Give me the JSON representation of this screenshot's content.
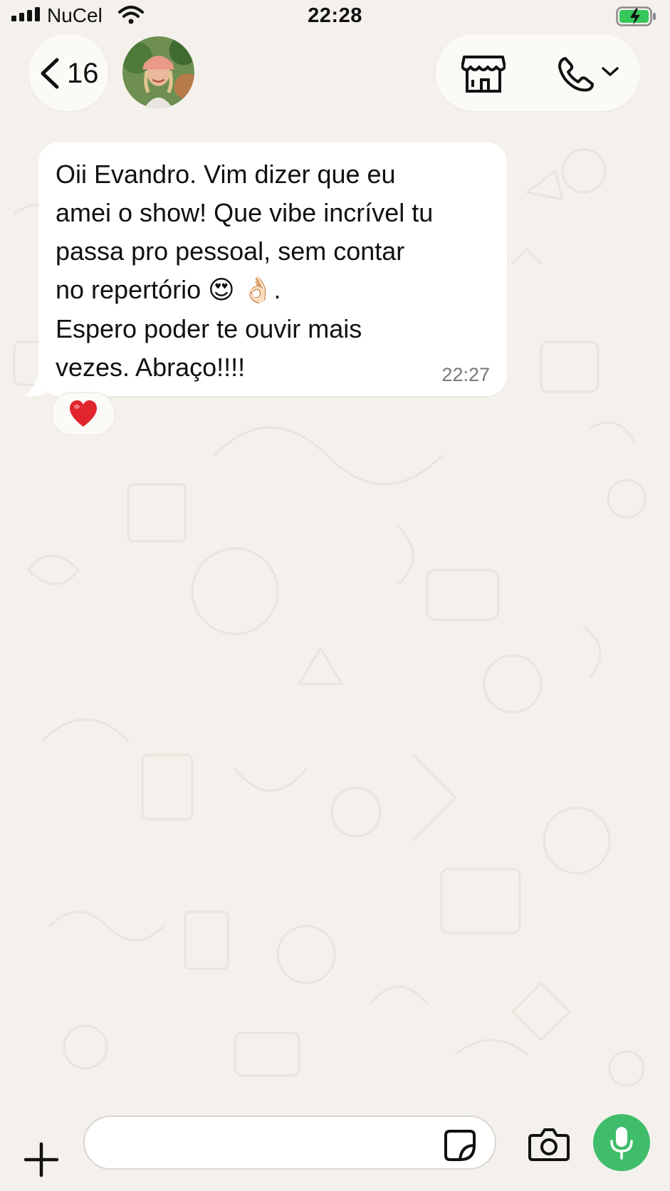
{
  "status_bar": {
    "carrier": "NuCel",
    "time": "22:28"
  },
  "header": {
    "back_count": "16",
    "avatar_icon": "contact-avatar-photo",
    "store_icon": "storefront-icon",
    "call_icon": "phone-icon",
    "call_menu_icon": "chevron-down-icon"
  },
  "conversation": {
    "messages": [
      {
        "direction": "incoming",
        "line1": "Oii Evandro. Vim dizer que eu",
        "line2": "amei o show! Que vibe incrível tu",
        "line3": "passa pro pessoal, sem contar",
        "line4_text": "no repertório ",
        "line4_emoji1": "😍",
        "line4_emoji2": "👌🏻",
        "line4_end": ".",
        "line5": "Espero poder te ouvir mais",
        "line6": "vezes. Abraço!!!!",
        "time": "22:27",
        "reaction": "❤️"
      }
    ]
  },
  "composer": {
    "input_value": "",
    "icons": [
      "plus-icon",
      "sticker-icon",
      "camera-icon",
      "microphone-icon"
    ]
  },
  "colors": {
    "background": "#f4f1ec",
    "bubble": "#ffffff",
    "mic_button": "#3fbd6b",
    "reaction_heart": "#e0252d"
  }
}
